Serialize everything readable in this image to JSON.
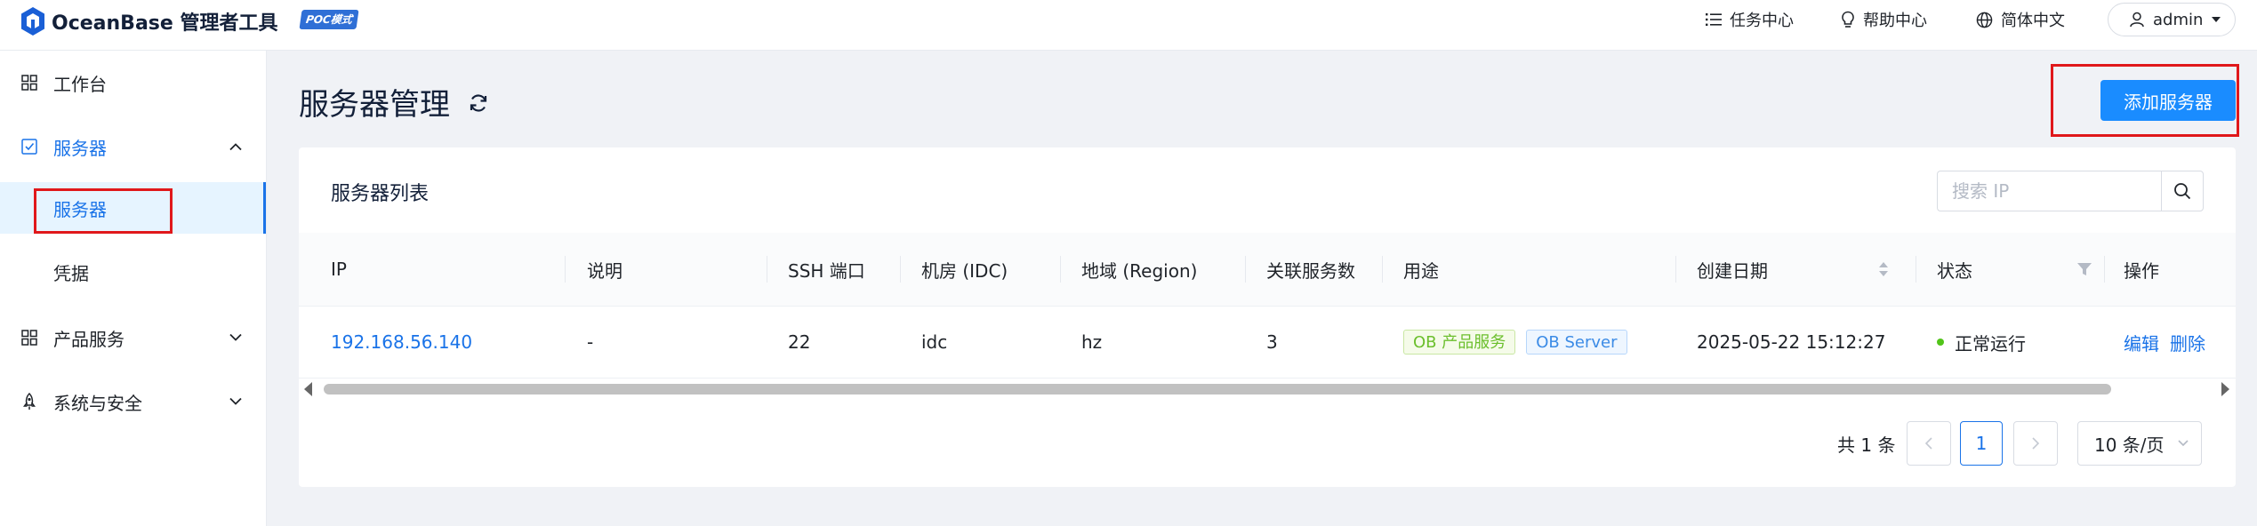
{
  "app": {
    "name": "OceanBase 管理者工具",
    "mode_badge": "POC模式"
  },
  "header": {
    "task_center": "任务中心",
    "help_center": "帮助中心",
    "language": "简体中文",
    "user": "admin"
  },
  "sidebar": {
    "workbench": "工作台",
    "servers_group": "服务器",
    "servers_item": "服务器",
    "credentials_item": "凭据",
    "product_services": "产品服务",
    "system_security": "系统与安全"
  },
  "page": {
    "title": "服务器管理",
    "add_button": "添加服务器"
  },
  "table": {
    "title": "服务器列表",
    "search_placeholder": "搜索 IP",
    "columns": {
      "ip": "IP",
      "desc": "说明",
      "ssh": "SSH 端口",
      "idc": "机房 (IDC)",
      "region": "地域 (Region)",
      "services": "关联服务数",
      "usage": "用途",
      "created": "创建日期",
      "status": "状态",
      "actions": "操作"
    },
    "rows": [
      {
        "ip": "192.168.56.140",
        "desc": "-",
        "ssh": "22",
        "idc": "idc",
        "region": "hz",
        "services": "3",
        "tag_product": "OB 产品服务",
        "tag_server": "OB Server",
        "created": "2025-05-22 15:12:27",
        "status": "正常运行",
        "edit": "编辑",
        "delete": "删除"
      }
    ]
  },
  "pagination": {
    "total": "共 1 条",
    "current": "1",
    "page_size": "10 条/页"
  },
  "colors": {
    "accent": "#1a73e8",
    "button": "#1a8cff",
    "highlight": "#e0181b",
    "status_ok": "#52c41a"
  }
}
